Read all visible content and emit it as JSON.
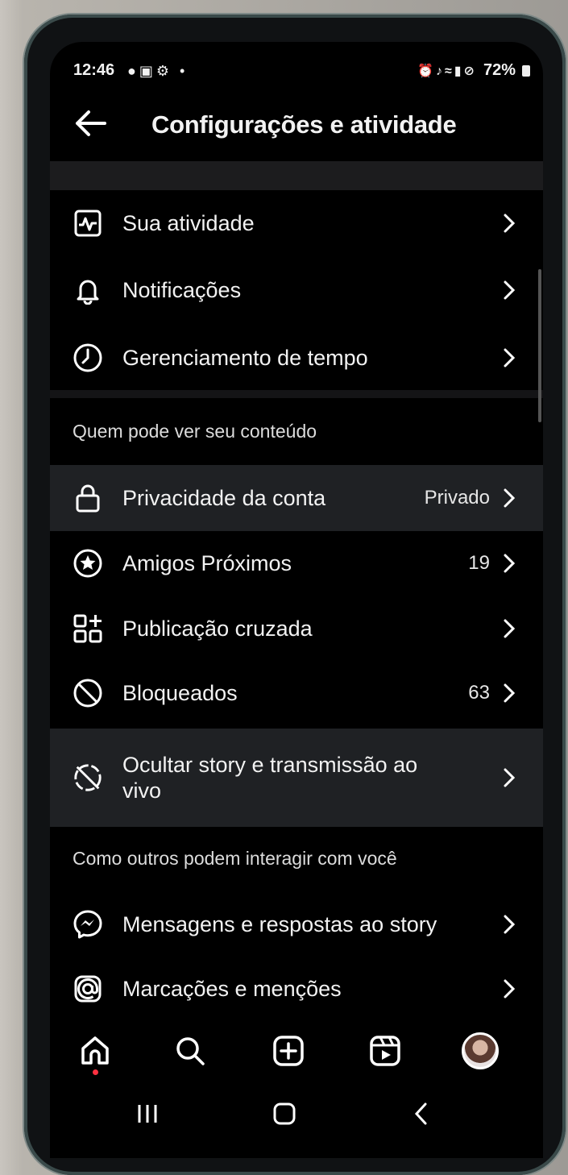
{
  "status_bar": {
    "time": "12:46",
    "battery": "72%"
  },
  "header": {
    "title": "Configurações e atividade"
  },
  "menu_top": [
    {
      "label": "Sua atividade",
      "icon": "activity-icon"
    },
    {
      "label": "Notificações",
      "icon": "bell-icon"
    },
    {
      "label": "Gerenciamento de tempo",
      "icon": "clock-icon"
    }
  ],
  "section_visibility": {
    "heading": "Quem pode ver seu conteúdo",
    "items": [
      {
        "label": "Privacidade da conta",
        "value": "Privado",
        "icon": "lock-icon"
      },
      {
        "label": "Amigos Próximos",
        "value": "19",
        "icon": "star-circle-icon"
      },
      {
        "label": "Publicação cruzada",
        "value": "",
        "icon": "grid-plus-icon"
      },
      {
        "label": "Bloqueados",
        "value": "63",
        "icon": "block-icon"
      },
      {
        "label": "Ocultar story e transmissão ao vivo",
        "value": "",
        "icon": "hide-story-icon"
      }
    ]
  },
  "section_interaction": {
    "heading": "Como outros podem interagir com você",
    "items": [
      {
        "label": "Mensagens e respostas ao story",
        "icon": "messenger-icon"
      },
      {
        "label": "Marcações e menções",
        "icon": "at-sign-icon"
      }
    ]
  },
  "bottom_nav": [
    "home-icon",
    "search-icon",
    "create-icon",
    "reels-icon",
    "profile-avatar"
  ],
  "system_nav": [
    "recent-apps-icon",
    "home-button-icon",
    "back-nav-icon"
  ],
  "colors": {
    "background": "#000000",
    "highlight_row": "#1f2124",
    "text": "#f2f2f2",
    "notification_dot": "#ff3040"
  }
}
